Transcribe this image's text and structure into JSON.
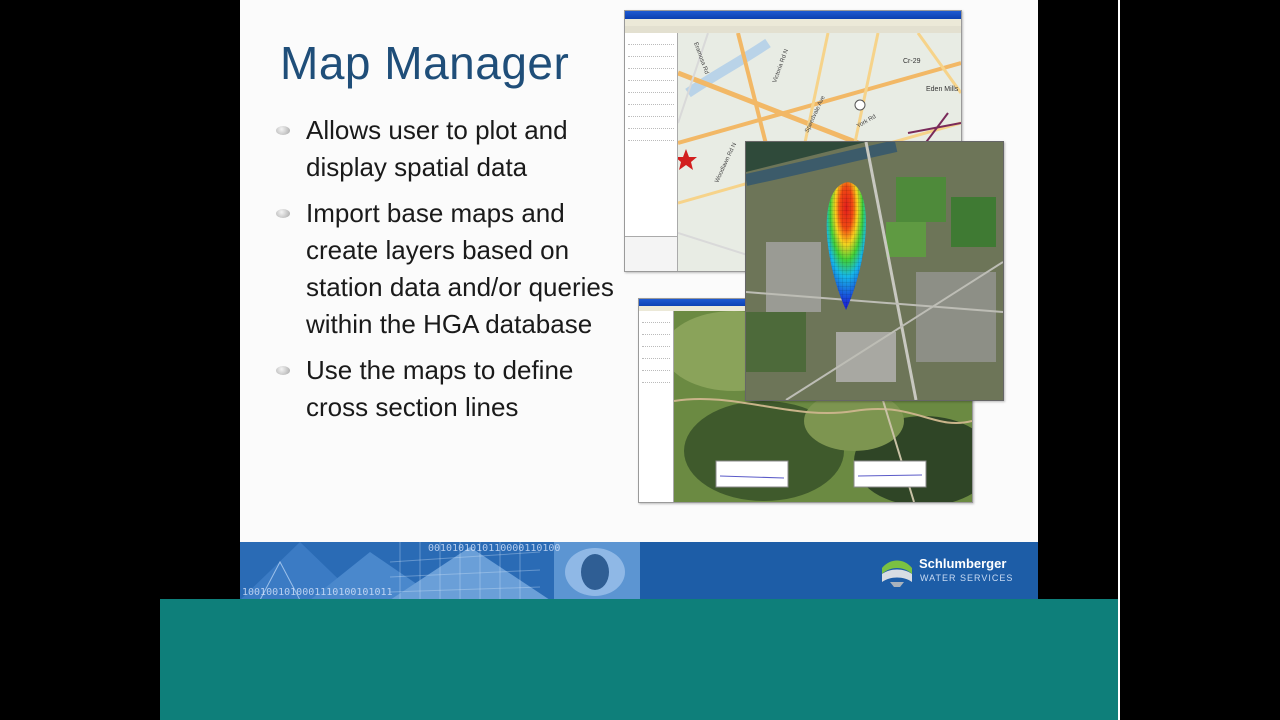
{
  "slide": {
    "title": "Map Manager",
    "bullets": [
      {
        "line1": "Allows user to plot and",
        "line2": "display spatial data"
      },
      {
        "line1": "Import base maps and",
        "line2": "create layers based on",
        "line3": "station data and/or queries",
        "line4": "within the HGA database"
      },
      {
        "line1": "Use the maps to define",
        "line2": "cross section lines"
      }
    ]
  },
  "map_labels": {
    "road_1": "Cr-29",
    "road_2": "Eden Mills",
    "road_3": "Woodlawn Rd N",
    "road_4": "Victoria Rd N",
    "road_5": "Speedvale Ave",
    "road_6": "Eramosa Rd",
    "road_7": "York Rd"
  },
  "banner": {
    "binary_top": "0010101010110000110100",
    "binary_bottom": "1001001010001110100101011",
    "company": "Schlumberger",
    "division": "WATER SERVICES"
  },
  "colors": {
    "title": "#1f4e79",
    "banner": "#1d5da7",
    "teal_bar": "#0e7f7a",
    "logo_green": "#7ac142"
  }
}
